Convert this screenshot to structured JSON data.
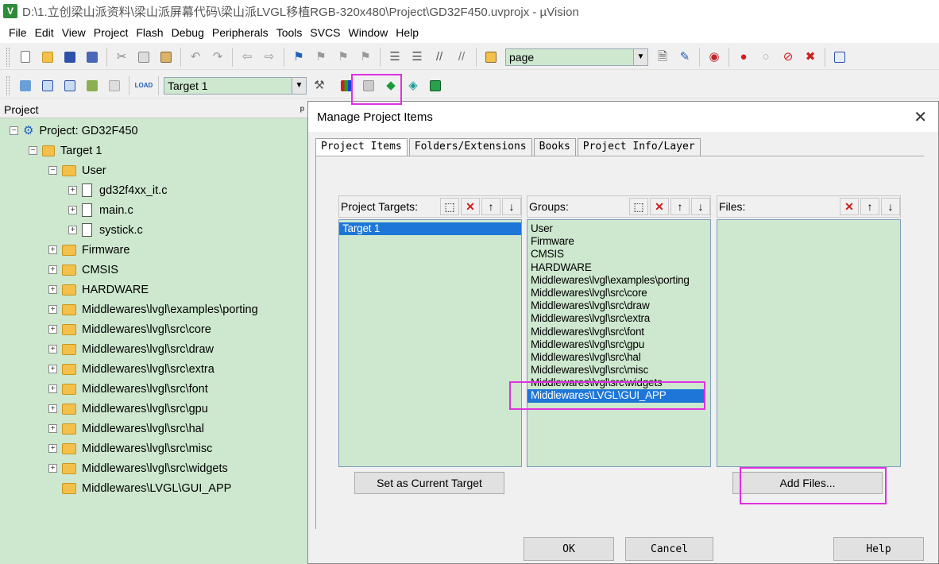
{
  "window": {
    "title": "D:\\1.立创梁山派资料\\梁山派屏幕代码\\梁山派LVGL移植RGB-320x480\\Project\\GD32F450.uvprojx - µVision",
    "icon_letter": "V"
  },
  "menu": [
    "File",
    "Edit",
    "View",
    "Project",
    "Flash",
    "Debug",
    "Peripherals",
    "Tools",
    "SVCS",
    "Window",
    "Help"
  ],
  "toolbar1": {
    "find_combo_value": "page"
  },
  "toolbar2": {
    "target_combo_value": "Target 1",
    "load_label": "LOAD"
  },
  "project_pane": {
    "header": "Project",
    "pin": "ᵖ",
    "root": "Project: GD32F450",
    "target": "Target 1",
    "user_group": "User",
    "user_files": [
      "gd32f4xx_it.c",
      "main.c",
      "systick.c"
    ],
    "groups": [
      "Firmware",
      "CMSIS",
      "HARDWARE",
      "Middlewares\\lvgl\\examples\\porting",
      "Middlewares\\lvgl\\src\\core",
      "Middlewares\\lvgl\\src\\draw",
      "Middlewares\\lvgl\\src\\extra",
      "Middlewares\\lvgl\\src\\font",
      "Middlewares\\lvgl\\src\\gpu",
      "Middlewares\\lvgl\\src\\hal",
      "Middlewares\\lvgl\\src\\misc",
      "Middlewares\\lvgl\\src\\widgets"
    ],
    "open_group": "Middlewares\\LVGL\\GUI_APP"
  },
  "dialog": {
    "title": "Manage Project Items",
    "tabs": [
      "Project Items",
      "Folders/Extensions",
      "Books",
      "Project Info/Layer"
    ],
    "targets_label": "Project Targets:",
    "targets": [
      "Target 1"
    ],
    "groups_label": "Groups:",
    "groups": [
      "User",
      "Firmware",
      "CMSIS",
      "HARDWARE",
      "Middlewares\\lvgl\\examples\\porting",
      "Middlewares\\lvgl\\src\\core",
      "Middlewares\\lvgl\\src\\draw",
      "Middlewares\\lvgl\\src\\extra",
      "Middlewares\\lvgl\\src\\font",
      "Middlewares\\lvgl\\src\\gpu",
      "Middlewares\\lvgl\\src\\hal",
      "Middlewares\\lvgl\\src\\misc",
      "Middlewares\\lvgl\\src\\widgets",
      "Middlewares\\LVGL\\GUI_APP"
    ],
    "files_label": "Files:",
    "set_current_label": "Set as Current Target",
    "add_files_label": "Add Files...",
    "ok_label": "OK",
    "cancel_label": "Cancel",
    "help_label": "Help"
  },
  "colors": {
    "pane_bg": "#cde8cf",
    "selection": "#1e76d8",
    "highlight": "#e030e0"
  }
}
